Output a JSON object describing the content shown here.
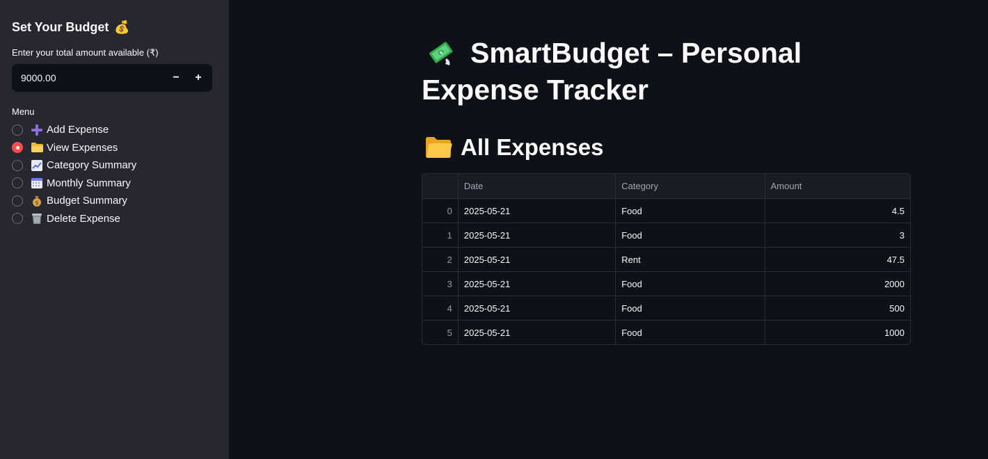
{
  "sidebar": {
    "title": "Set Your Budget",
    "title_emoji": "💰",
    "amount_label": "Enter your total amount available (₹)",
    "amount_value": "9000.00",
    "decrement_label": "−",
    "increment_label": "+",
    "menu_label": "Menu",
    "menu_items": [
      {
        "label": "Add Expense",
        "icon": "plus-icon",
        "selected": false
      },
      {
        "label": "View Expenses",
        "icon": "folder-icon",
        "selected": true
      },
      {
        "label": "Category Summary",
        "icon": "chart-icon",
        "selected": false
      },
      {
        "label": "Monthly Summary",
        "icon": "calendar-icon",
        "selected": false
      },
      {
        "label": "Budget Summary",
        "icon": "money-bag-icon",
        "selected": false
      },
      {
        "label": "Delete Expense",
        "icon": "trash-icon",
        "selected": false
      }
    ]
  },
  "main": {
    "title": "SmartBudget – Personal Expense Tracker",
    "section_title": "All Expenses",
    "table": {
      "columns": [
        "",
        "Date",
        "Category",
        "Amount"
      ],
      "rows": [
        {
          "index": "0",
          "date": "2025-05-21",
          "category": "Food",
          "amount": "4.5"
        },
        {
          "index": "1",
          "date": "2025-05-21",
          "category": "Food",
          "amount": "3"
        },
        {
          "index": "2",
          "date": "2025-05-21",
          "category": "Rent",
          "amount": "47.5"
        },
        {
          "index": "3",
          "date": "2025-05-21",
          "category": "Food",
          "amount": "2000"
        },
        {
          "index": "4",
          "date": "2025-05-21",
          "category": "Food",
          "amount": "500"
        },
        {
          "index": "5",
          "date": "2025-05-21",
          "category": "Food",
          "amount": "1000"
        }
      ]
    }
  },
  "colors": {
    "background": "#0e1117",
    "sidebar": "#262730",
    "accent": "#ff4b4b",
    "text": "#fafafa"
  }
}
